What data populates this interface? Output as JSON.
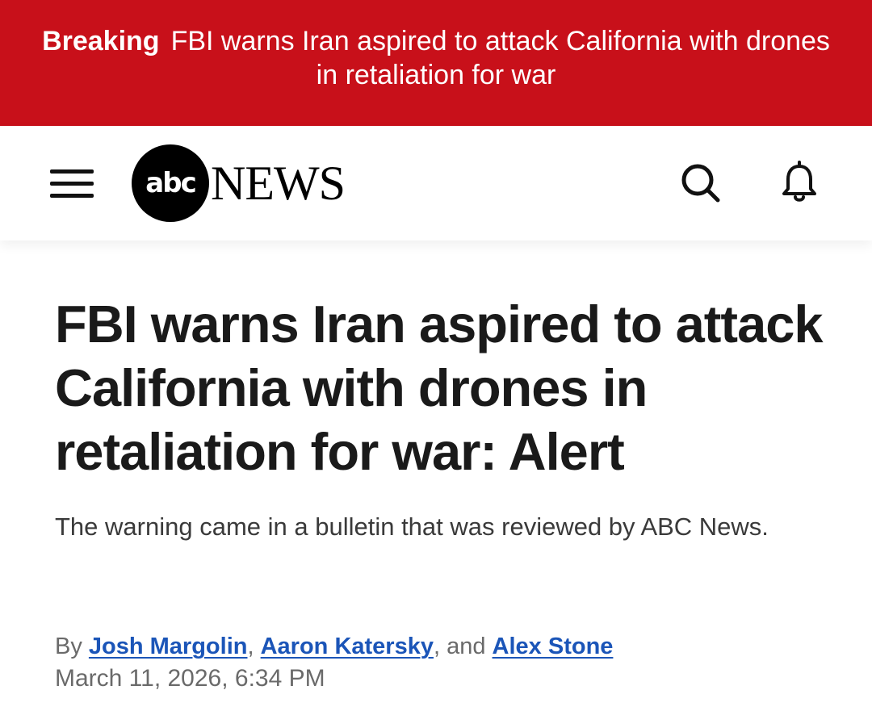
{
  "breaking_banner": {
    "label": "Breaking",
    "headline": "FBI warns Iran aspired to attack California with drones in retaliation for war",
    "background_color": "#c8101a"
  },
  "header": {
    "menu_icon": "hamburger-menu-icon",
    "logo": {
      "circle_text": "abc",
      "wordmark": "NEWS"
    },
    "search_icon": "search-icon",
    "notifications_icon": "bell-icon"
  },
  "article": {
    "headline": "FBI warns Iran aspired to attack California with drones in retaliation for war: Alert",
    "subheadline": "The warning came in a bulletin that was reviewed by ABC News.",
    "byline": {
      "prefix": "By",
      "authors": [
        "Josh Margolin",
        "Aaron Katersky",
        "Alex Stone"
      ],
      "separator_1": ",",
      "separator_2": ", and",
      "link_color": "#1b55b8"
    },
    "timestamp": "March 11, 2026, 6:34 PM"
  }
}
